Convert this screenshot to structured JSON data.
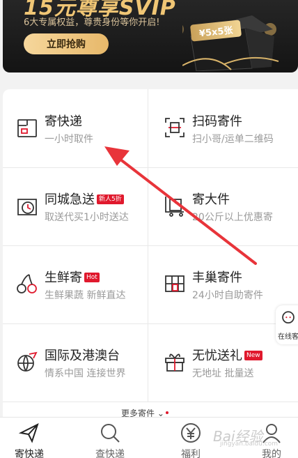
{
  "banner": {
    "title": "15元尊享SVIP",
    "subtitle": "6大专属权益，尊贵身份等你开启!",
    "cta": "立即抢购",
    "coupon": "¥5x5张"
  },
  "services": [
    {
      "title": "寄快递",
      "sub": "一小时取件",
      "badge": "",
      "icon": "send-box-icon"
    },
    {
      "title": "扫码寄件",
      "sub": "扫小哥/运单二维码",
      "badge": "",
      "icon": "scan-icon"
    },
    {
      "title": "同城急送",
      "sub": "取送代买1小时送达",
      "badge": "新人5折",
      "icon": "clock-box-icon"
    },
    {
      "title": "寄大件",
      "sub": "20公斤以上优惠寄",
      "badge": "",
      "icon": "cart-box-icon"
    },
    {
      "title": "生鲜寄",
      "sub": "生鲜果蔬 新鲜直达",
      "badge": "Hot",
      "icon": "cherry-icon"
    },
    {
      "title": "丰巢寄件",
      "sub": "24小时自助寄件",
      "badge": "",
      "icon": "locker-icon"
    },
    {
      "title": "国际及港澳台",
      "sub": "情系中国 连接世界",
      "badge": "",
      "icon": "globe-plane-icon"
    },
    {
      "title": "无忧送礼",
      "sub": "无地址 批量送",
      "badge": "New",
      "icon": "gift-icon"
    }
  ],
  "more_label": "更多寄件",
  "online_label": "在线客",
  "tabs": [
    {
      "label": "寄快递",
      "icon": "paper-plane-icon",
      "active": true
    },
    {
      "label": "查快递",
      "icon": "search-icon",
      "active": false
    },
    {
      "label": "福利",
      "icon": "yen-icon",
      "active": false
    },
    {
      "label": "我的",
      "icon": "user-icon",
      "active": false
    }
  ],
  "watermark": "Bai经验",
  "watermark_sub": "jingyan.baidu.com",
  "colors": {
    "accent": "#e0192d",
    "gold": "#f0c675",
    "text": "#222222",
    "subtext": "#9a9a9a"
  }
}
